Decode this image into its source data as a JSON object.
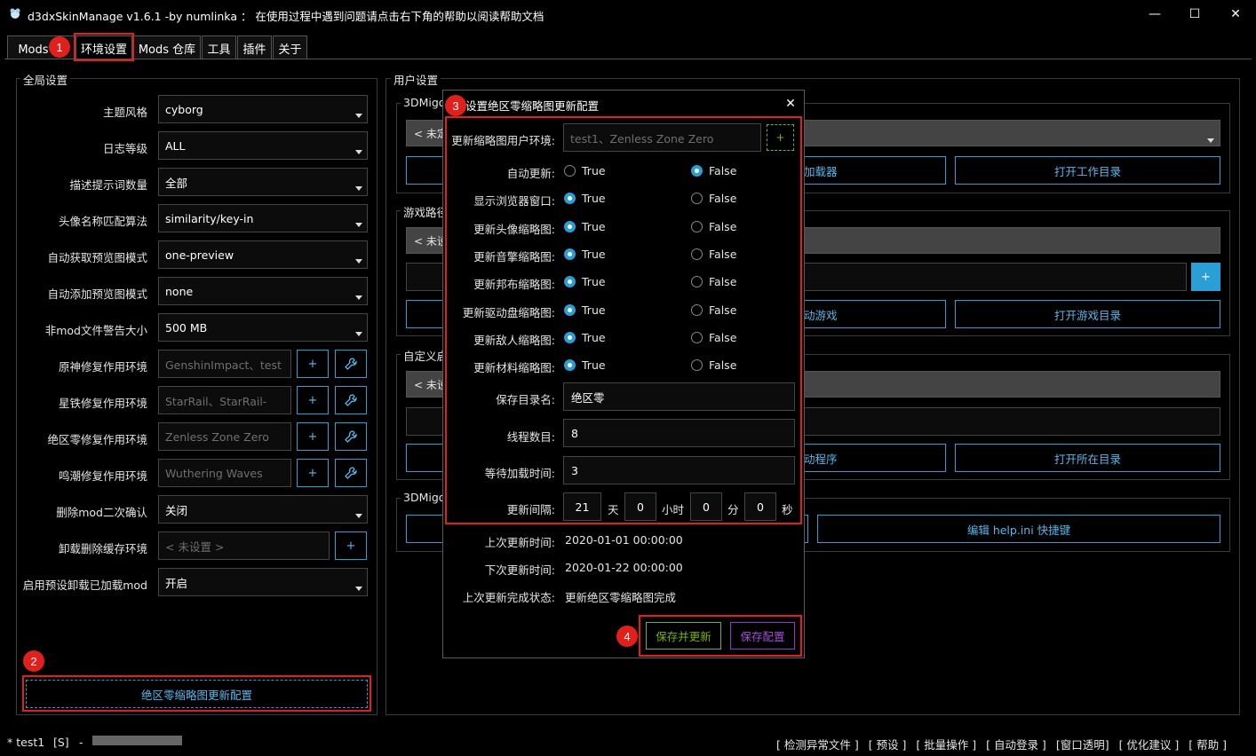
{
  "window": {
    "title": "d3dxSkinManage v1.6.1 -by numlinka ： 在使用过程中遇到问题请点击右下角的帮助以阅读帮助文档",
    "minimize": "—",
    "maximize": "☐",
    "close": "✕"
  },
  "tabs": [
    {
      "label": "Mods 管"
    },
    {
      "label": "环境设置"
    },
    {
      "label": "Mods 仓库"
    },
    {
      "label": "工具"
    },
    {
      "label": "插件"
    },
    {
      "label": "关于"
    }
  ],
  "global_settings": {
    "title": "全局设置",
    "rows": [
      {
        "label": "主题风格",
        "value": "cyborg"
      },
      {
        "label": "日志等级",
        "value": "ALL"
      },
      {
        "label": "描述提示词数量",
        "value": "全部"
      },
      {
        "label": "头像名称匹配算法",
        "value": "similarity/key-in"
      },
      {
        "label": "自动获取预览图模式",
        "value": "one-preview"
      },
      {
        "label": "自动添加预览图模式",
        "value": "none"
      },
      {
        "label": "非mod文件警告大小",
        "value": "500 MB"
      },
      {
        "label": "原神修复作用环境",
        "value": "GenshinImpact、test"
      },
      {
        "label": "星铁修复作用环境",
        "value": "StarRail、StarRail-"
      },
      {
        "label": "绝区零修复作用环境",
        "value": "Zenless Zone Zero"
      },
      {
        "label": "鸣潮修复作用环境",
        "value": "Wuthering Waves"
      },
      {
        "label": "删除mod二次确认",
        "value": "关闭"
      },
      {
        "label": "卸载删除缓存环境",
        "value": "< 未设置 >"
      },
      {
        "label": "启用预设卸载已加载mod",
        "value": "开启"
      }
    ],
    "plus": "+",
    "bottom_button": "绝区零缩略图更新配置"
  },
  "user_settings": {
    "title": "用户设置",
    "group1_title": "3DMigo",
    "group1_bar": "< 未定",
    "group1_btn_a": "加载器",
    "group1_btn_b": "打开工作目录",
    "group2_title": "游戏路径",
    "group2_bar": "< 未设",
    "group2_plus": "+",
    "group2_btn_a": "动游戏",
    "group2_btn_b": "打开游戏目录",
    "group3_title": "自定义启",
    "group3_bar": "< 未设",
    "group3_btn_a": "动程序",
    "group3_btn_b": "打开所在目录",
    "group4_title": "3DMigo",
    "group4_btn_b": "编辑 help.ini 快捷键"
  },
  "dialog": {
    "title": "设置绝区零缩略图更新配置",
    "close": "✕",
    "env_label": "更新缩略图用户环境:",
    "env_placeholder": "test1、Zenless Zone Zero",
    "env_plus": "+",
    "true_label": "True",
    "false_label": "False",
    "options": [
      {
        "label": "自动更新:",
        "value": false
      },
      {
        "label": "显示浏览器窗口:",
        "value": true
      },
      {
        "label": "更新头像缩略图:",
        "value": true
      },
      {
        "label": "更新音擎缩略图:",
        "value": true
      },
      {
        "label": "更新邦布缩略图:",
        "value": true
      },
      {
        "label": "更新驱动盘缩略图:",
        "value": true
      },
      {
        "label": "更新敌人缩略图:",
        "value": true
      },
      {
        "label": "更新材料缩略图:",
        "value": true
      }
    ],
    "save_dir_label": "保存目录名:",
    "save_dir_value": "绝区零",
    "threads_label": "线程数目:",
    "threads_value": "8",
    "wait_label": "等待加载时间:",
    "wait_value": "3",
    "interval_label": "更新间隔:",
    "interval": {
      "days": "21",
      "days_unit": "天",
      "hours": "0",
      "hours_unit": "小时",
      "minutes": "0",
      "minutes_unit": "分",
      "seconds": "0",
      "seconds_unit": "秒"
    },
    "last_update_label": "上次更新时间:",
    "last_update_value": "2020-01-01 00:00:00",
    "next_update_label": "下次更新时间:",
    "next_update_value": "2020-01-22 00:00:00",
    "last_status_label": "上次更新完成状态:",
    "last_status_value": "更新绝区零缩略图完成",
    "save_update_button": "保存并更新",
    "save_config_button": "保存配置"
  },
  "annotations": [
    "1",
    "2",
    "3",
    "4"
  ],
  "statusbar": {
    "user": "* test1",
    "slot": "[S]",
    "dash": "-",
    "links": [
      "[ 检测异常文件 ]",
      "[ 预设 ]",
      "[ 批量操作 ]",
      "[ 自动登录 ]",
      "[窗口透明]",
      "[ 优化建议 ]",
      "[ 帮助 ]"
    ]
  },
  "colors": {
    "accent": "#2a9fd6",
    "annotation": "#e0201d",
    "save_update": "#77b300",
    "save_config": "#9933cc"
  }
}
